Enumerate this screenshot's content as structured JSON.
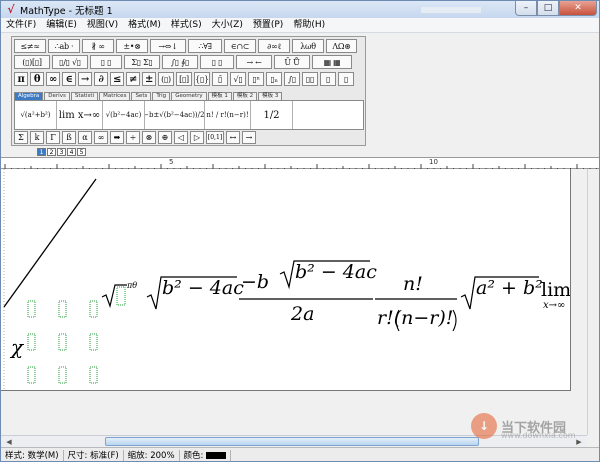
{
  "window": {
    "title": "MathType - 无标题 1",
    "app_icon": "√",
    "minimize": "–",
    "maximize": "□",
    "close": "✕"
  },
  "menu": [
    "文件(F)",
    "编辑(E)",
    "视图(V)",
    "格式(M)",
    "样式(S)",
    "大小(Z)",
    "预置(P)",
    "帮助(H)"
  ],
  "palette": {
    "row1": [
      "≤≠≈",
      "∴ab ·",
      "∦ ∞",
      "±•⊗",
      "→⇔↓",
      "∴∀∃",
      "∈∩⊂",
      "∂∞ℓ",
      "λωθ",
      "ΛΩ⊛"
    ],
    "row2": [
      "(▯)[▯]",
      "▯/▯ √▯",
      "▯ ▯",
      "Σ▯ Σ▯",
      "∫▯ ∮▯",
      "▯ ▯",
      "→ ←",
      "Ū Ů",
      "▦ ▦"
    ],
    "row3": [
      "π",
      "θ",
      "∞",
      "∈",
      "→",
      "∂",
      "≤",
      "≠",
      "±",
      "(▯)",
      "[▯]",
      "{▯}",
      "▯̄",
      "√▯",
      "▯ⁿ",
      "▯ₙ",
      "∫▯",
      "▯▯",
      "▯",
      "▯"
    ],
    "tabs": [
      "Algebra",
      "Derivs",
      "Statisti",
      "Matrices",
      "Sets",
      "Trig",
      "Geometry",
      "模板 1",
      "模板 2",
      "模板 3"
    ],
    "templates": [
      "√(a²+b²)",
      "lim x→∞",
      "√(b²−4ac)",
      "(−b±√(b²−4ac))/2a",
      "n! / r!(n−r)!",
      "1/2"
    ],
    "symbols": [
      "Σ",
      "k",
      "Γ",
      "ß",
      "α",
      "∞",
      "➡",
      "÷",
      "⊗",
      "⊕",
      "◁",
      "▷",
      "[0,1]",
      "↔",
      "→"
    ]
  },
  "zoom_buttons": [
    "1",
    "2",
    "3",
    "4",
    "5"
  ],
  "ruler": {
    "marks": [
      "5",
      "10"
    ]
  },
  "formula": {
    "chi": "χ",
    "pi_theta": "πθ",
    "sqrt1": "b² − 4ac",
    "frac_num": "−b ± √(b² − 4ac)",
    "frac_den": "2a",
    "comb_num": "n!",
    "comb_den": "r!(n−r)!",
    "sqrt2": "a² + b²",
    "lim": "lim",
    "lim_sub": "x→∞"
  },
  "status": {
    "style_label": "样式:",
    "style_value": "数学(M)",
    "size_label": "尺寸:",
    "size_value": "标准(F)",
    "zoom_label": "缩放:",
    "zoom_value": "200%",
    "color_label": "颜色:",
    "color_value": "#000000"
  },
  "watermark": {
    "text": "当下软件园",
    "sub": "www.downxia.com"
  }
}
